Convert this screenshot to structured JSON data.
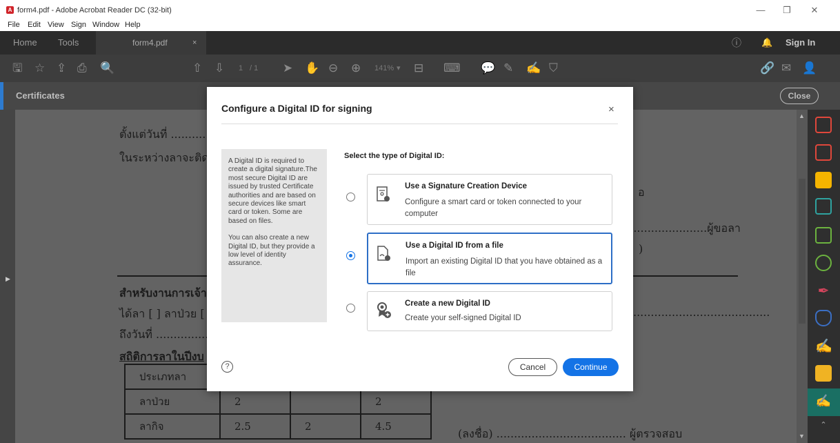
{
  "window": {
    "title": "form4.pdf - Adobe Acrobat Reader DC (32-bit)",
    "minimize": "—",
    "restore": "❐",
    "close": "✕"
  },
  "menu": [
    "File",
    "Edit",
    "View",
    "Sign",
    "Window",
    "Help"
  ],
  "tabs": {
    "home": "Home",
    "tools": "Tools",
    "file": "form4.pdf",
    "file_close": "×",
    "sign_in": "Sign In"
  },
  "toolbar": {
    "page_current": "1",
    "page_total": "/ 1",
    "zoom": "141%"
  },
  "certificates": {
    "label": "Certificates",
    "close": "Close"
  },
  "document": {
    "line1": "ตั้งแต่วันที่ ...........",
    "line2": "ในระหว่างลาจะติด",
    "right1": "อ",
    "right2": ".........................ผู้ขอลา",
    "right3": ")",
    "line3": "สำหรับงานการเจ้า",
    "line4": "ได้ลา [ ] ลาป่วย [",
    "line5": "ถึงวันที่ ..................",
    "line6": "สถิติการลาในปีงบ",
    "right4": ".......................................",
    "table": {
      "rows": [
        [
          "ประเภทลา",
          "",
          "",
          ""
        ],
        [
          "ลาป่วย",
          "2",
          "",
          "2"
        ],
        [
          "ลากิจ",
          "2.5",
          "2",
          "4.5"
        ]
      ]
    },
    "sign_line": "(ลงชื่อ) ..................................... ผู้ตรวจสอบ"
  },
  "dialog": {
    "title": "Configure a Digital ID for signing",
    "close": "×",
    "info_p1": "A Digital ID is required to create a digital signature.The most secure Digital ID are issued by trusted Certificate authorities and are based on secure devices like smart card or token. Some are based on files.",
    "info_p2": "You can also create a new Digital ID, but they provide a low level of identity assurance.",
    "select_label": "Select the type of Digital ID:",
    "options": [
      {
        "title": "Use a Signature Creation Device",
        "desc": "Configure a smart card or token connected to your computer",
        "checked": false
      },
      {
        "title": "Use a Digital ID from a file",
        "desc": "Import an existing Digital ID that you have obtained as a file",
        "checked": true
      },
      {
        "title": "Create a new Digital ID",
        "desc": "Create your self-signed Digital ID",
        "checked": false
      }
    ],
    "help": "?",
    "cancel": "Cancel",
    "continue": "Continue"
  },
  "colors": {
    "accent": "#1473e6",
    "dark_bar": "#2b2b2b"
  }
}
